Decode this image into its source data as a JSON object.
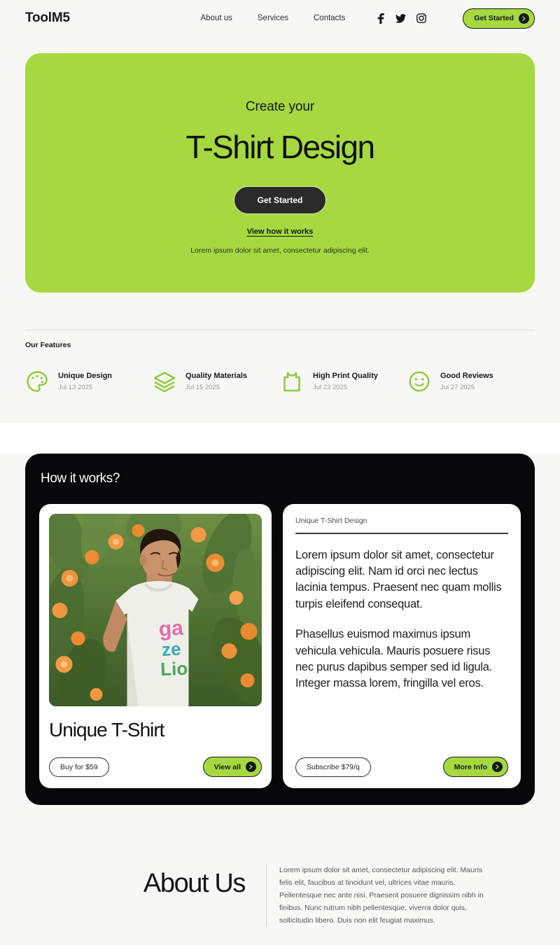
{
  "header": {
    "logo": "ToolM5",
    "nav": [
      {
        "label": "About us"
      },
      {
        "label": "Services"
      },
      {
        "label": "Contacts"
      }
    ],
    "social": [
      {
        "name": "facebook-icon"
      },
      {
        "name": "twitter-icon"
      },
      {
        "name": "instagram-icon"
      }
    ],
    "cta_label": "Get Started"
  },
  "hero": {
    "eyebrow": "Create your",
    "title": "T-Shirt Design",
    "cta_label": "Get Started",
    "link_label": "View how it works",
    "subtext": "Lorem ipsum dolor sit amet, consectetur adipiscing elit.",
    "background_color": "#a5d93f"
  },
  "features": {
    "label": "Our Features",
    "items": [
      {
        "icon": "palette-icon",
        "title": "Unique Design",
        "date": "Jul 13 2025"
      },
      {
        "icon": "layers-icon",
        "title": "Quality Materials",
        "date": "Jul 15 2025"
      },
      {
        "icon": "tshirt-icon",
        "title": "High Print Quality",
        "date": "Jul 23 2025"
      },
      {
        "icon": "smiley-icon",
        "title": "Good Reviews",
        "date": "Jul 27 2025"
      }
    ]
  },
  "works": {
    "title": "How it works?",
    "left_card": {
      "image_alt": "Man wearing white gazelio graphic t-shirt in orange flower field",
      "heading": "Unique T-Shirt",
      "buy_label": "Buy for $59",
      "view_label": "View all"
    },
    "right_card": {
      "label": "Unique T-Shirt Design",
      "paragraph_1": "Lorem ipsum dolor sit amet, consectetur adipiscing elit. Nam id orci nec lectus lacinia tempus. Praesent nec quam mollis turpis eleifend consequat.",
      "paragraph_2": "Phasellus euismod maximus ipsum vehicula vehicula. Mauris posuere risus nec purus dapibus semper sed id ligula. Integer massa lorem, fringilla vel eros.",
      "subscribe_label": "Subscribe $79/q",
      "more_label": "More Info"
    }
  },
  "about": {
    "title": "About Us",
    "text": "Lorem ipsum dolor sit amet, consectetur adipiscing elit. Mauris felis elit, faucibus at tincidunt vel, ultrices vitae mauris. Pellentesque nec ante nisi. Praesent posuere dignissim nibh in finibus. Nunc rutrum nibh pellentesque, viverra dolor quis, sollicitudin libero. Duis non elit feugiat maximus."
  },
  "colors": {
    "accent_green": "#a5d93f",
    "dark": "#08080a",
    "page_bg": "#f7f7f5"
  }
}
